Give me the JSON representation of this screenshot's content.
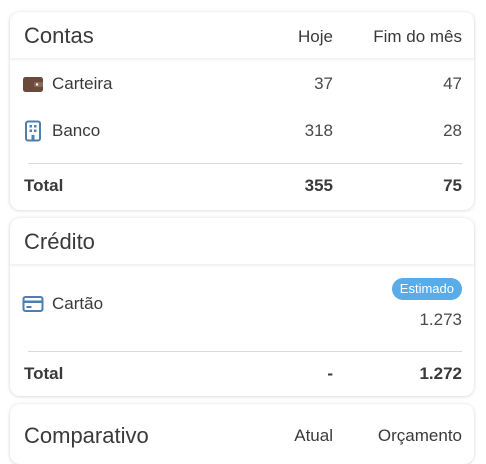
{
  "contas": {
    "title": "Contas",
    "col_today": "Hoje",
    "col_month_end": "Fim do mês",
    "rows": [
      {
        "label": "Carteira",
        "icon": "wallet-icon",
        "icon_color": "#6b4a3c",
        "today": "37",
        "month_end": "47"
      },
      {
        "label": "Banco",
        "icon": "bank-building-icon",
        "icon_color": "#4f7fae",
        "today": "318",
        "month_end": "28"
      }
    ],
    "total": {
      "label": "Total",
      "today": "355",
      "month_end": "75"
    }
  },
  "credito": {
    "title": "Crédito",
    "rows": [
      {
        "label": "Cartão",
        "icon": "credit-card-icon",
        "icon_color": "#4f7fae",
        "badge": "Estimado",
        "badge_color": "#5aace8",
        "value": "1.273"
      }
    ],
    "total": {
      "label": "Total",
      "today": "-",
      "month_end": "1.272"
    }
  },
  "comparativo": {
    "title": "Comparativo",
    "col_actual": "Atual",
    "col_budget": "Orçamento"
  }
}
